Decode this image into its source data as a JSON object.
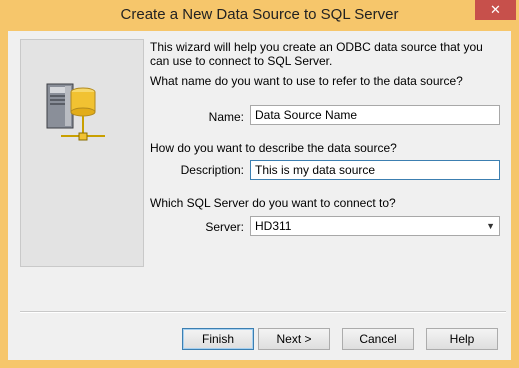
{
  "window": {
    "title": "Create a New Data Source to SQL Server",
    "close_glyph": "✕"
  },
  "side_panel": {
    "icon": "database-server-icon"
  },
  "intro": {
    "text": "This wizard will help you create an ODBC data source that you can use to connect to SQL Server."
  },
  "name_section": {
    "question": "What name do you want to use to refer to the data source?",
    "label": "Name:",
    "value": "Data Source Name"
  },
  "description_section": {
    "question": "How do you want to describe the data source?",
    "label": "Description:",
    "value": "This is my data source"
  },
  "server_section": {
    "question": "Which SQL Server do you want to connect to?",
    "label": "Server:",
    "value": "HD311"
  },
  "buttons": {
    "finish": "Finish",
    "next": "Next >",
    "cancel": "Cancel",
    "help": "Help"
  }
}
